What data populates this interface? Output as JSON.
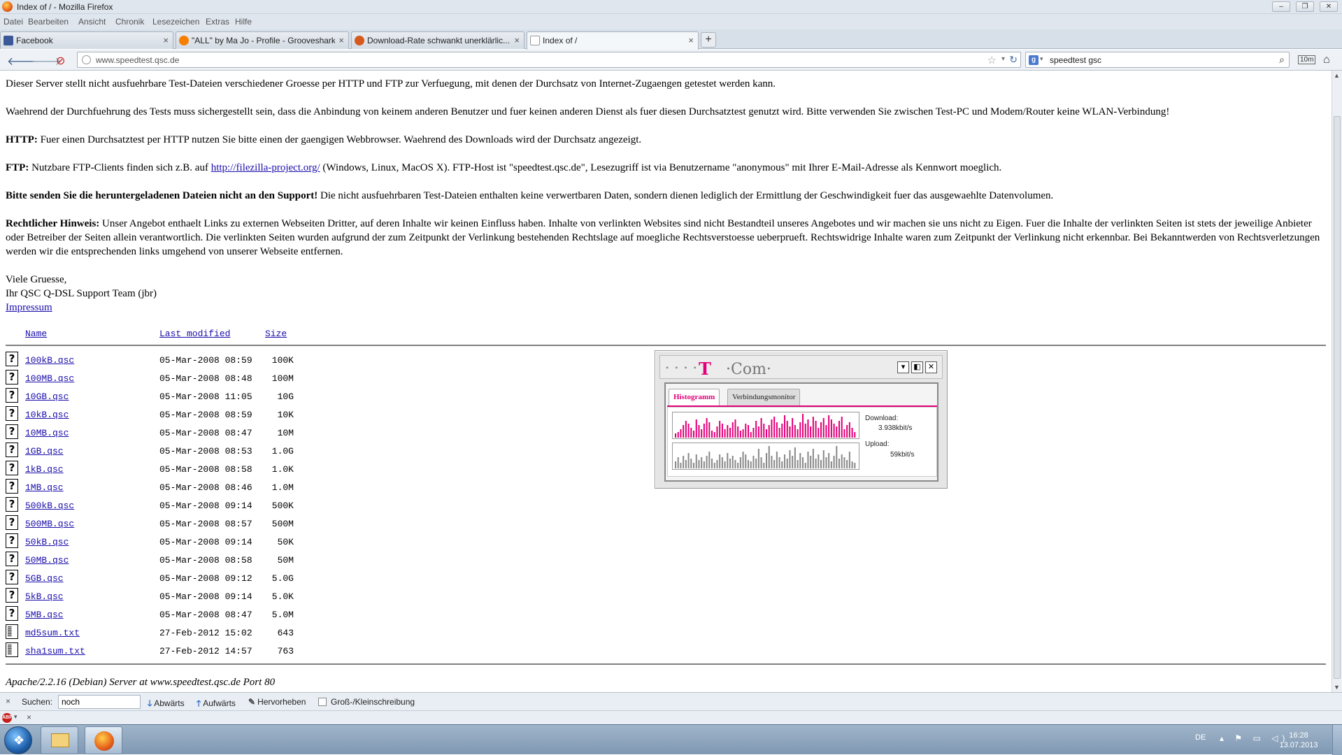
{
  "window": {
    "title": "Index of / - Mozilla Firefox",
    "controls": [
      "–",
      "❐",
      "✕"
    ]
  },
  "menubar": [
    "Datei",
    "Bearbeiten",
    "Ansicht",
    "Chronik",
    "Lesezeichen",
    "Extras",
    "Hilfe"
  ],
  "tabs": [
    {
      "label": "Facebook",
      "icon": "facebook-icon",
      "color": "#3b5998",
      "close": "×"
    },
    {
      "label": "\"ALL\" by Ma Jo - Profile - Grooveshark",
      "icon": "grooveshark-icon",
      "color": "#f77f00",
      "close": "×"
    },
    {
      "label": "Download-Rate schwankt unerklärlic...",
      "icon": "forum-icon",
      "color": "#d65a1e",
      "close": "×"
    },
    {
      "label": "Index of /",
      "icon": "page-icon",
      "color": "#ffffff",
      "close": "×"
    }
  ],
  "newtab": "+",
  "nav": {
    "back": "🡐",
    "forward": "🡒",
    "stop": "⊘",
    "url": "www.speedtest.qsc.de",
    "star": "☆",
    "dropdown": "▾",
    "reload": "↻",
    "search_engine": "g",
    "search_value": "speedtest gsc",
    "search_icon": "⌕",
    "extra1": "10m",
    "home": "⌂"
  },
  "page": {
    "intro": "Dieser Server stellt nicht ausfuehrbare Test-Dateien verschiedener Groesse per HTTP und FTP zur Verfuegung, mit denen der Durchsatz von Internet-Zugaengen getestet werden kann.",
    "p2": "Waehrend der Durchfuehrung des Tests muss sichergestellt sein, dass die Anbindung von keinem anderen Benutzer und fuer keinen anderen Dienst als fuer diesen Durchsatztest genutzt wird. Bitte verwenden Sie zwischen Test-PC und Modem/Router keine WLAN-Verbindung!",
    "http_label": "HTTP:",
    "http_text": " Fuer einen Durchsatztest per HTTP nutzen Sie bitte einen der gaengigen Webbrowser. Waehrend des Downloads wird der Durchsatz angezeigt.",
    "ftp_label": "FTP:",
    "ftp_text1": " Nutzbare FTP-Clients finden sich z.B. auf ",
    "ftp_link": "http://filezilla-project.org/",
    "ftp_text2": " (Windows, Linux, MacOS X). FTP-Host ist \"speedtest.qsc.de\", Lesezugriff ist via Benutzername \"anonymous\" mit Ihrer E-Mail-Adresse als Kennwort moeglich.",
    "support_bold": "Bitte senden Sie die heruntergeladenen Dateien nicht an den Support!",
    "support_text": " Die nicht ausfuehrbaren Test-Dateien enthalten keine verwertbaren Daten, sondern dienen lediglich der Ermittlung der Geschwindigkeit fuer das ausgewaehlte Datenvolumen.",
    "legal_bold": "Rechtlicher Hinweis:",
    "legal_text": " Unser Angebot enthaelt Links zu externen Webseiten Dritter, auf deren Inhalte wir keinen Einfluss haben. Inhalte von verlinkten Websites sind nicht Bestandteil unseres Angebotes und wir machen sie uns nicht zu Eigen. Fuer die Inhalte der verlinkten Seiten ist stets der jeweilige Anbieter oder Betreiber der Seiten allein verantwortlich. Die verlinkten Seiten wurden aufgrund der zum Zeitpunkt der Verlinkung bestehenden Rechtslage auf moegliche Rechtsverstoesse ueberprueft. Rechtswidrige Inhalte waren zum Zeitpunkt der Verlinkung nicht erkennbar. Bei Bekanntwerden von Rechtsverletzungen werden wir die entsprechenden links umgehend von unserer Webseite entfernen.",
    "greeting": "Viele Gruesse,",
    "team": "Ihr QSC Q-DSL Support Team (jbr)",
    "impressum": "Impressum",
    "col_name": "Name",
    "col_modified": "Last modified",
    "col_size": "Size",
    "files": [
      {
        "name": "100kB.qsc",
        "date": "05-Mar-2008 08:59",
        "size": "100K",
        "icon": "?"
      },
      {
        "name": "100MB.qsc",
        "date": "05-Mar-2008 08:48",
        "size": "100M",
        "icon": "?"
      },
      {
        "name": "10GB.qsc",
        "date": "05-Mar-2008 11:05",
        "size": "10G",
        "icon": "?"
      },
      {
        "name": "10kB.qsc",
        "date": "05-Mar-2008 08:59",
        "size": "10K",
        "icon": "?"
      },
      {
        "name": "10MB.qsc",
        "date": "05-Mar-2008 08:47",
        "size": "10M",
        "icon": "?"
      },
      {
        "name": "1GB.qsc",
        "date": "05-Mar-2008 08:53",
        "size": "1.0G",
        "icon": "?"
      },
      {
        "name": "1kB.qsc",
        "date": "05-Mar-2008 08:58",
        "size": "1.0K",
        "icon": "?"
      },
      {
        "name": "1MB.qsc",
        "date": "05-Mar-2008 08:46",
        "size": "1.0M",
        "icon": "?"
      },
      {
        "name": "500kB.qsc",
        "date": "05-Mar-2008 09:14",
        "size": "500K",
        "icon": "?"
      },
      {
        "name": "500MB.qsc",
        "date": "05-Mar-2008 08:57",
        "size": "500M",
        "icon": "?"
      },
      {
        "name": "50kB.qsc",
        "date": "05-Mar-2008 09:14",
        "size": "50K",
        "icon": "?"
      },
      {
        "name": "50MB.qsc",
        "date": "05-Mar-2008 08:58",
        "size": "50M",
        "icon": "?"
      },
      {
        "name": "5GB.qsc",
        "date": "05-Mar-2008 09:12",
        "size": "5.0G",
        "icon": "?"
      },
      {
        "name": "5kB.qsc",
        "date": "05-Mar-2008 09:14",
        "size": "5.0K",
        "icon": "?"
      },
      {
        "name": "5MB.qsc",
        "date": "05-Mar-2008 08:47",
        "size": "5.0M",
        "icon": "?"
      },
      {
        "name": "md5sum.txt",
        "date": "27-Feb-2012 15:02",
        "size": "643",
        "icon": "txt"
      },
      {
        "name": "sha1sum.txt",
        "date": "27-Feb-2012 14:57",
        "size": "763",
        "icon": "txt"
      }
    ],
    "server_sig": "Apache/2.2.16 (Debian) Server at www.speedtest.qsc.de Port 80"
  },
  "tcom": {
    "dots": "• • • •",
    "logo_t": "T",
    "logo_com": "·Com·",
    "tab_active": "Histogramm",
    "tab_inactive": "Verbindungsmonitor",
    "download_label": "Download:",
    "download_value": "3.938kbit/s",
    "upload_label": "Upload:",
    "upload_value": "59kbit/s",
    "accent": "#e2007a",
    "download_bars": [
      3,
      4,
      6,
      9,
      12,
      10,
      7,
      5,
      13,
      9,
      6,
      10,
      14,
      11,
      5,
      4,
      8,
      12,
      10,
      6,
      9,
      7,
      11,
      13,
      8,
      5,
      6,
      10,
      9,
      4,
      7,
      12,
      8,
      14,
      10,
      6,
      9,
      13,
      15,
      11,
      7,
      10,
      16,
      12,
      8,
      14,
      9,
      6,
      11,
      17,
      10,
      13,
      8,
      15,
      12,
      7,
      11,
      14,
      9,
      16,
      13,
      10,
      8,
      12,
      15,
      6,
      9,
      11,
      7,
      4
    ],
    "upload_bars": [
      5,
      8,
      4,
      9,
      6,
      11,
      7,
      4,
      10,
      6,
      8,
      5,
      9,
      12,
      7,
      4,
      6,
      10,
      8,
      5,
      11,
      7,
      9,
      6,
      4,
      8,
      12,
      10,
      6,
      5,
      9,
      7,
      14,
      8,
      4,
      11,
      16,
      9,
      6,
      12,
      8,
      5,
      10,
      7,
      13,
      9,
      15,
      6,
      11,
      8,
      4,
      12,
      9,
      14,
      7,
      10,
      6,
      13,
      8,
      11,
      5,
      9,
      16,
      7,
      10,
      8,
      6,
      12,
      5,
      4
    ]
  },
  "findbar": {
    "close": "×",
    "label": "Suchen:",
    "value": "noch",
    "down_label": "Abwärts",
    "up_label": "Aufwärts",
    "highlight_label": "Hervorheben",
    "case_label": "Groß-/Kleinschreibung"
  },
  "addonbar": {
    "abp": "ABP",
    "close": "×"
  },
  "taskbar": {
    "start": "❖",
    "lang": "DE",
    "tray_icons": "▴ ⚑ ▭ ◁)",
    "time": "16:28",
    "date": "13.07.2013"
  }
}
